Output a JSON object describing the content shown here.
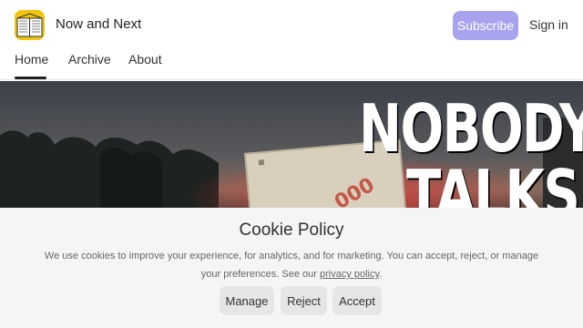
{
  "header": {
    "brand": "Now and Next",
    "subscribe_label": "Subscribe",
    "signin_label": "Sign in"
  },
  "nav": {
    "items": [
      {
        "label": "Home"
      },
      {
        "label": "Archive"
      },
      {
        "label": "About"
      }
    ],
    "active": "Home"
  },
  "hero": {
    "headline_line1": "NOBODY",
    "headline_line2": "TALKS"
  },
  "cookie": {
    "title": "Cookie Policy",
    "text_part1": "We use cookies to improve your experience, for analytics, and for marketing. You can accept, reject, or manage your preferences. See our ",
    "link_text": "privacy policy",
    "text_part2": ".",
    "manage_label": "Manage",
    "reject_label": "Reject",
    "accept_label": "Accept"
  },
  "colors": {
    "subscribe_bg": "#a8a3ef",
    "cookie_bg": "#f5f5f5",
    "button_bg": "#e6e6e6"
  }
}
